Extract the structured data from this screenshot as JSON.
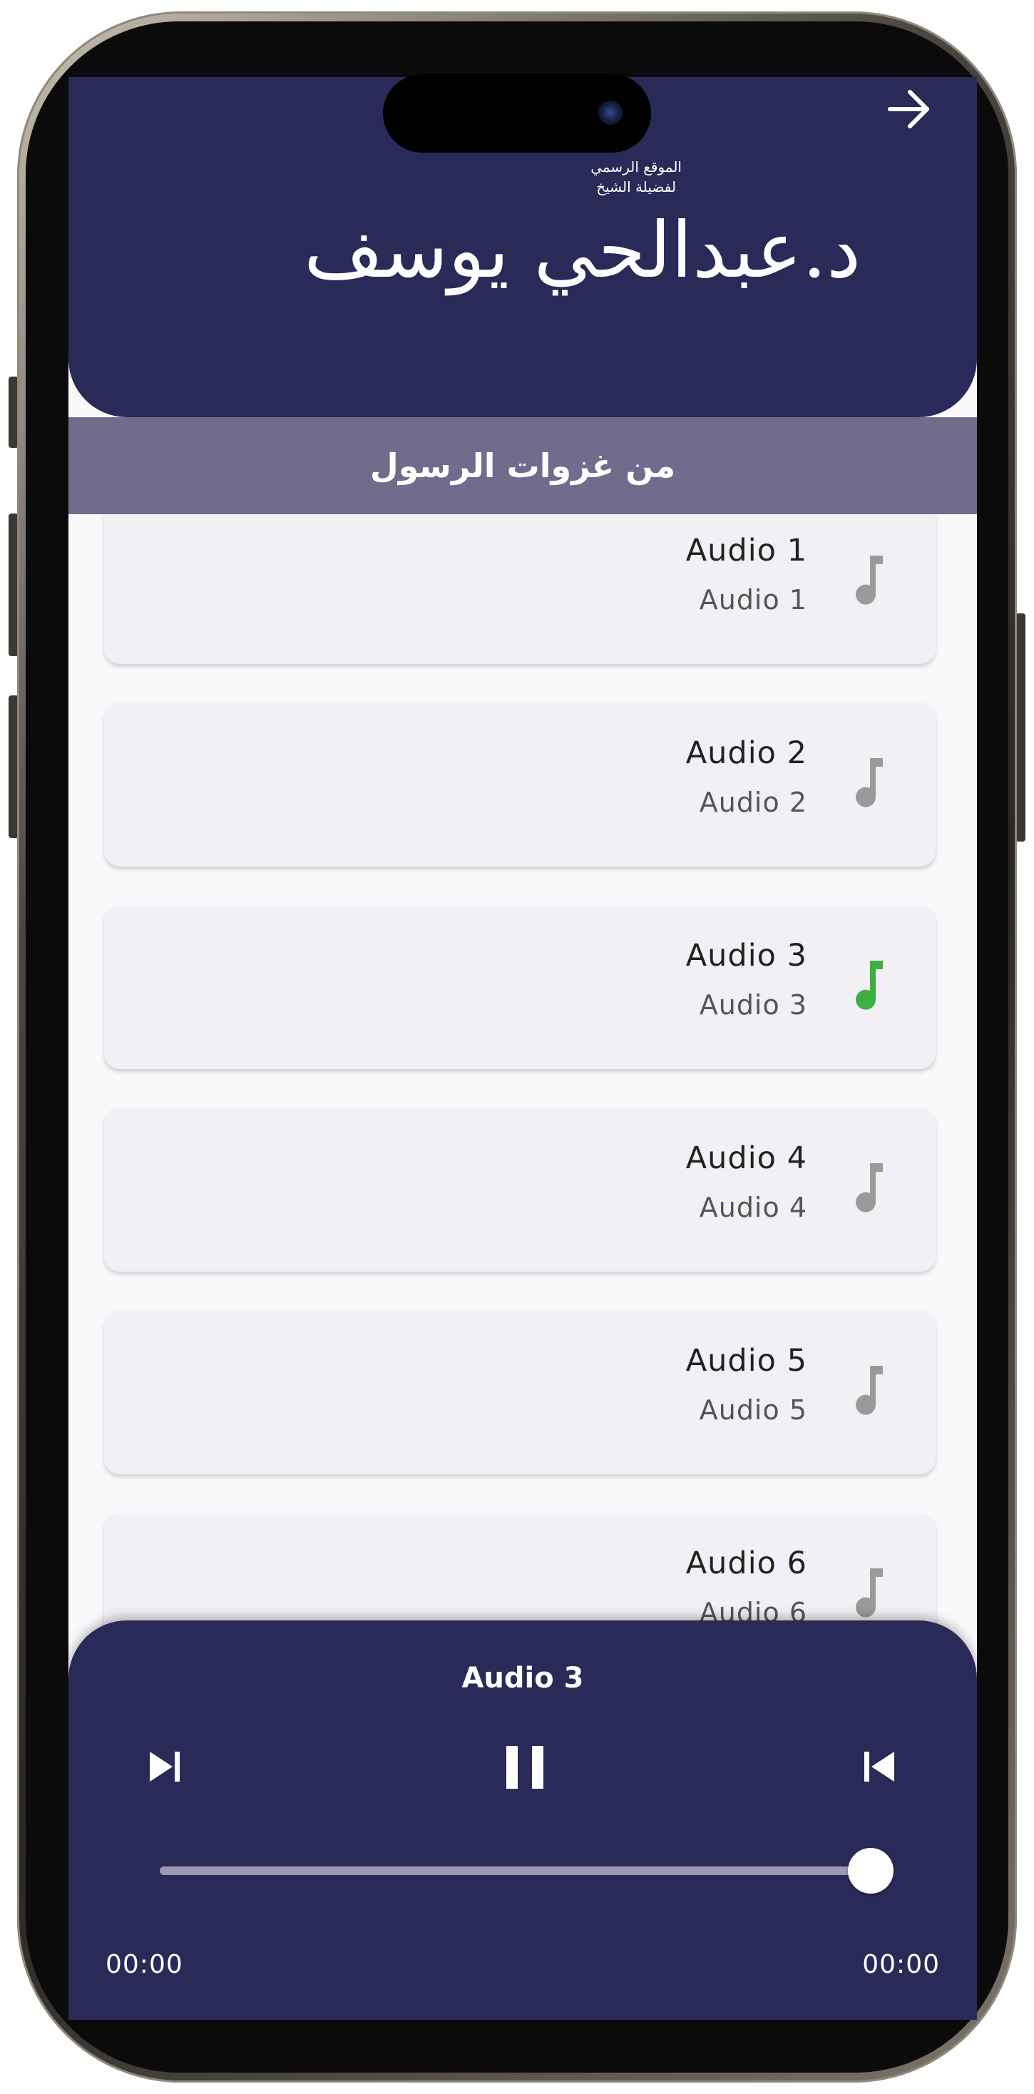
{
  "header": {
    "back_icon": "arrow-right-icon",
    "logo_main_text": "د.عبدالحي يوسف",
    "logo_small_line1": "الموقع الرسمي",
    "logo_small_line2": "لفضيلة الشيخ"
  },
  "titlebar": {
    "title": "من غزوات الرسول"
  },
  "list": {
    "items": [
      {
        "title": "Audio 1",
        "subtitle": "Audio 1",
        "icon": "music-note-icon",
        "icon_color": "#9a9a9a",
        "active": false
      },
      {
        "title": "Audio 2",
        "subtitle": "Audio 2",
        "icon": "music-note-icon",
        "icon_color": "#9a9a9a",
        "active": false
      },
      {
        "title": "Audio 3",
        "subtitle": "Audio 3",
        "icon": "music-note-icon",
        "icon_color": "#3cb043",
        "active": true
      },
      {
        "title": "Audio 4",
        "subtitle": "Audio 4",
        "icon": "music-note-icon",
        "icon_color": "#9a9a9a",
        "active": false
      },
      {
        "title": "Audio 5",
        "subtitle": "Audio 5",
        "icon": "music-note-icon",
        "icon_color": "#9a9a9a",
        "active": false
      },
      {
        "title": "Audio 6",
        "subtitle": "Audio 6",
        "icon": "music-note-icon",
        "icon_color": "#9a9a9a",
        "active": false
      }
    ]
  },
  "player": {
    "now_playing": "Audio 3",
    "elapsed": "00:00",
    "duration": "00:00",
    "progress_fraction": 1.0,
    "controls": {
      "next_icon": "skip-next-icon",
      "pause_icon": "pause-icon",
      "prev_icon": "skip-previous-icon"
    }
  },
  "colors": {
    "header_bg": "#2a2a58",
    "titlebar_bg": "#706c8c",
    "page_bg": "#fbf8fc",
    "card_bg": "#f3f0f5",
    "active_icon": "#3cb043",
    "inactive_icon": "#9a9a9a"
  }
}
